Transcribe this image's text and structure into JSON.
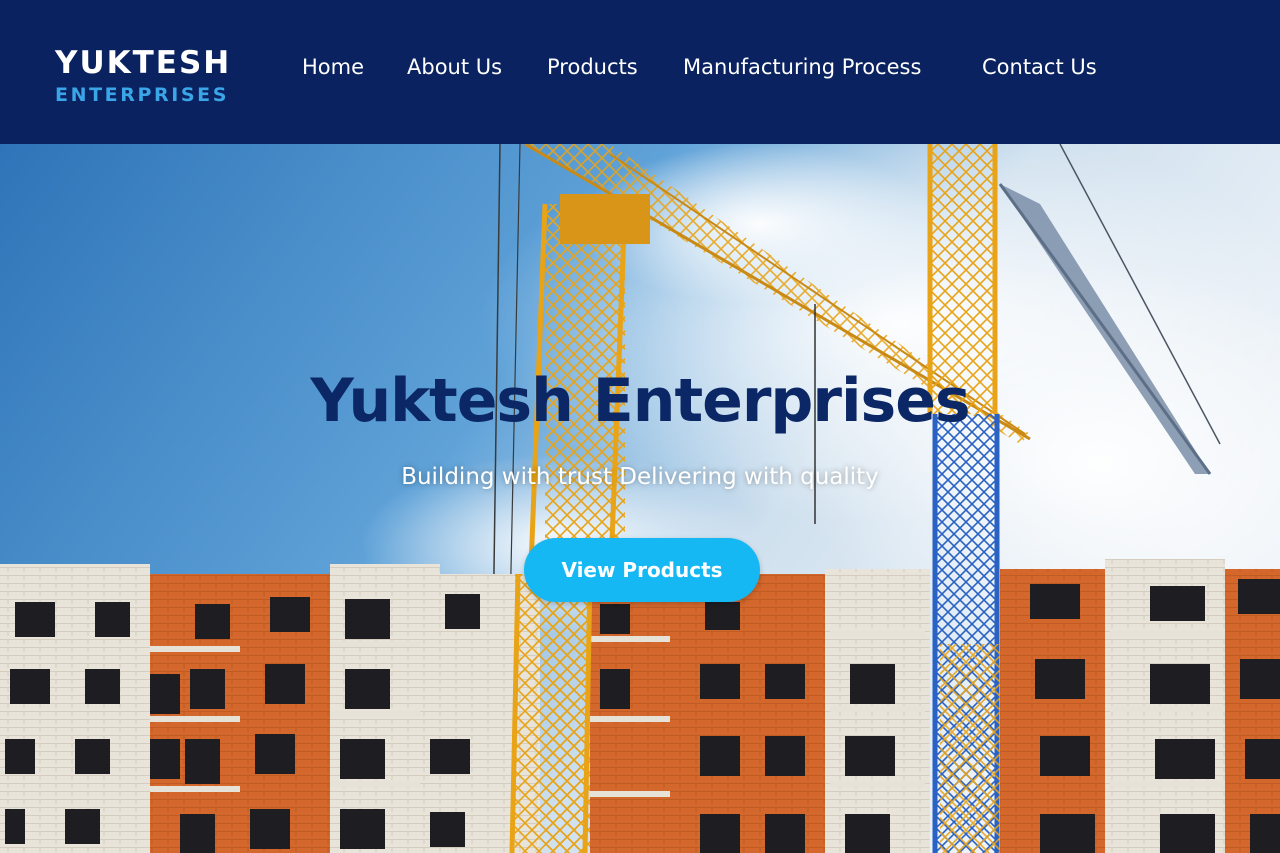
{
  "brand": {
    "name": "YUKTESH",
    "tagline": "ENTERPRISES"
  },
  "nav": {
    "items": [
      {
        "label": "Home"
      },
      {
        "label": "About Us"
      },
      {
        "label": "Products"
      },
      {
        "label": "Manufacturing Process"
      },
      {
        "label": "Contact Us"
      }
    ]
  },
  "hero": {
    "title": "Yuktesh Enterprises",
    "subtitle": "Building with trust Delivering with quality",
    "cta_label": "View Products",
    "image_description_icon": "construction-cranes-building-image"
  },
  "colors": {
    "header_bg": "#0a2260",
    "logo_accent": "#3aa6e8",
    "cta_bg": "#16b8f3",
    "title_color": "#0b2766"
  }
}
